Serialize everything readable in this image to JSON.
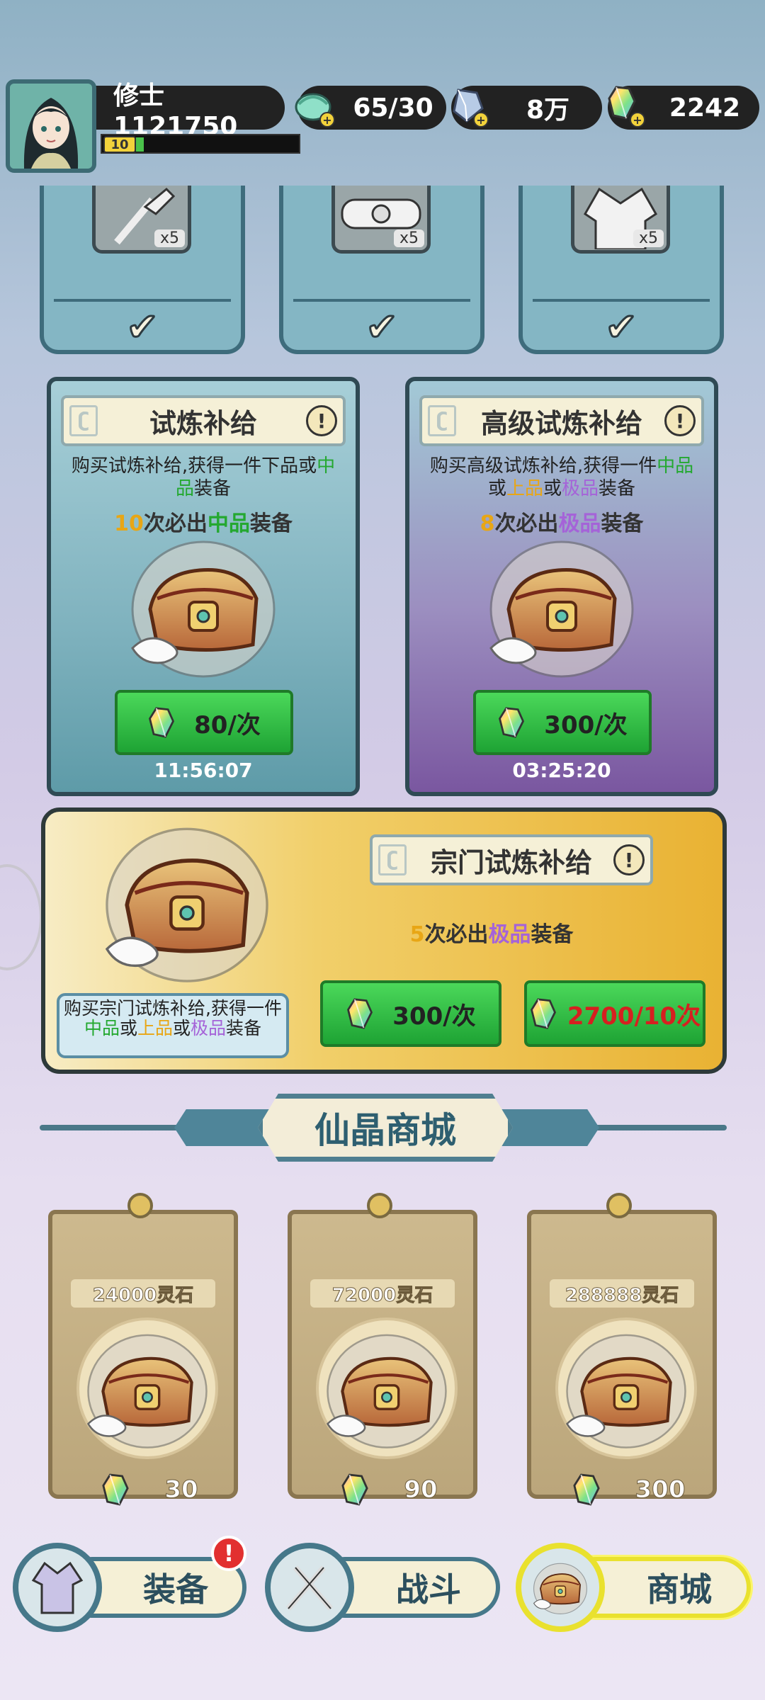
{
  "player": {
    "name": "修士1121750",
    "level": "10",
    "level_progress": 0.05
  },
  "resources": [
    {
      "name": "stamina",
      "icon": "stamina-orb-icon",
      "value": "65/30"
    },
    {
      "name": "ore",
      "icon": "ore-crystal-icon",
      "value": "8万"
    },
    {
      "name": "gem",
      "icon": "rainbow-gem-icon",
      "value": "2242"
    }
  ],
  "top_items": [
    {
      "icon": "sword-icon",
      "qty": "x5",
      "claimed": true
    },
    {
      "icon": "belt-icon",
      "qty": "x5",
      "claimed": true
    },
    {
      "icon": "robe-icon",
      "qty": "x5",
      "claimed": true
    }
  ],
  "supplies": [
    {
      "title": "试炼补给",
      "desc_parts": [
        "购买试炼补给,获得一件下品或",
        "中品",
        "装备"
      ],
      "guarantee_num": "10",
      "guarantee_mid": "次必出",
      "guarantee_grade": "中品",
      "guarantee_tail": "装备",
      "price": "80/次",
      "timer": "11:56:07"
    },
    {
      "title": "高级试炼补给",
      "desc_parts": [
        "购买高级试炼补给,获得一件",
        "中品",
        "或",
        "上品",
        "或",
        "极品",
        "装备"
      ],
      "guarantee_num": "8",
      "guarantee_mid": "次必出",
      "guarantee_grade": "极品",
      "guarantee_tail": "装备",
      "price": "300/次",
      "timer": "03:25:20"
    }
  ],
  "sect": {
    "title": "宗门试炼补给",
    "guarantee_num": "5",
    "guarantee_mid": "次必出",
    "guarantee_grade": "极品",
    "guarantee_tail": "装备",
    "desc_parts": [
      "购买宗门试炼补给,获得一件",
      "中品",
      "或",
      "上品",
      "或",
      "极品",
      "装备"
    ],
    "price_single": "300/次",
    "price_ten": "2700/10次"
  },
  "shop": {
    "title": "仙晶商城",
    "items": [
      {
        "label": "24000灵石",
        "cost": "30"
      },
      {
        "label": "72000灵石",
        "cost": "90"
      },
      {
        "label": "288888灵石",
        "cost": "300"
      }
    ]
  },
  "nav": [
    {
      "label": "装备",
      "icon": "equipment-robe-icon",
      "badge": "!"
    },
    {
      "label": "战斗",
      "icon": "crossed-swords-icon"
    },
    {
      "label": "商城",
      "icon": "treasure-chest-icon",
      "active": true
    }
  ],
  "colors": {
    "green": "#24a830",
    "purple": "#a563d8",
    "orange": "#e8a615",
    "red": "#e23030",
    "teal_frame": "#46788a"
  }
}
